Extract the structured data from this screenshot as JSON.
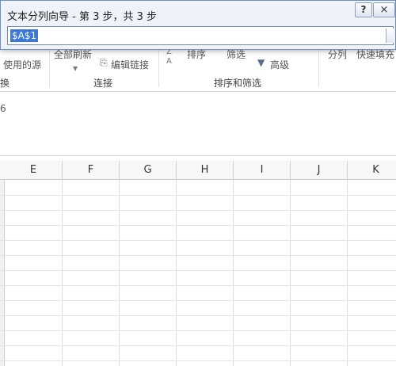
{
  "dialog": {
    "title": "文本分列向导 - 第 3 步，共 3 步",
    "help_label": "?",
    "close_label": "×",
    "range_value": "$A$1"
  },
  "ribbon": {
    "partial_use_source": "使用的源",
    "refresh_all": "全部刷新",
    "edit_links": "编辑链接",
    "sort": "排序",
    "filter": "筛选",
    "advanced": "高级",
    "split_columns": "分列",
    "flash_fill": "快速填充",
    "groups": {
      "convert_partial": "换",
      "connections": "连接",
      "sort_filter": "排序和筛选"
    },
    "sort_icon_top": "Z",
    "sort_icon_bottom": "A"
  },
  "gap_area": {
    "partial_char": "6"
  },
  "grid": {
    "columns": [
      "E",
      "F",
      "G",
      "H",
      "I",
      "J",
      "K"
    ]
  }
}
